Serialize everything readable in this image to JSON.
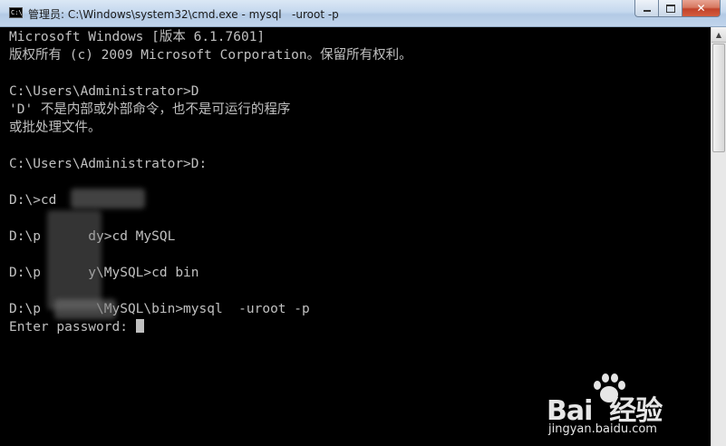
{
  "window": {
    "title": "管理员: C:\\Windows\\system32\\cmd.exe - mysql   -uroot -p",
    "icon": "cmd-icon",
    "icon_glyph": "C:\\"
  },
  "caption_buttons": {
    "minimize_icon": "minimize-icon",
    "maximize_icon": "maximize-icon",
    "close_icon": "close-icon",
    "close_glyph": "✕"
  },
  "console": {
    "lines": [
      "Microsoft Windows [版本 6.1.7601]",
      "版权所有 (c) 2009 Microsoft Corporation。保留所有权利。",
      "",
      "C:\\Users\\Administrator>D",
      "'D' 不是内部或外部命令，也不是可运行的程序",
      "或批处理文件。",
      "",
      "C:\\Users\\Administrator>D:",
      "",
      "D:\\>cd",
      "",
      "D:\\p      dy>cd MySQL",
      "",
      "D:\\p      y\\MySQL>cd bin",
      "",
      "D:\\p       \\MySQL\\bin>mysql  -uroot -p",
      "Enter password: "
    ],
    "text_color": "#c0c0c0",
    "background": "#000000"
  },
  "scrollbar": {
    "up_glyph": "▲"
  },
  "watermark": {
    "brand": "Bai  经验",
    "url": "jingyan.baidu.com"
  }
}
